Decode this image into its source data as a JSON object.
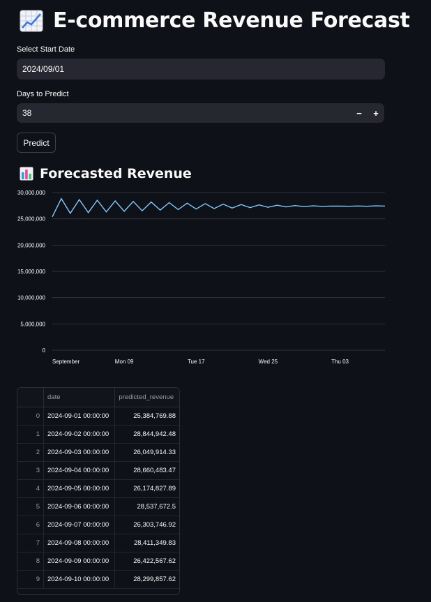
{
  "header": {
    "title": "E-commerce Revenue Forecast",
    "icon": "chart-increasing-icon"
  },
  "form": {
    "start_date_label": "Select Start Date",
    "start_date_value": "2024/09/01",
    "days_label": "Days to Predict",
    "days_value": "38",
    "minus_label": "−",
    "plus_label": "+",
    "predict_label": "Predict"
  },
  "forecast": {
    "title": "Forecasted Revenue",
    "icon": "bar-chart-icon"
  },
  "chart_data": {
    "type": "line",
    "y_ticks": [
      "30,000,000",
      "25,000,000",
      "20,000,000",
      "15,000,000",
      "10,000,000",
      "5,000,000",
      "0"
    ],
    "x_ticks": [
      "September",
      "Mon 09",
      "Tue 17",
      "Wed 25",
      "Thu 03"
    ],
    "ylim": [
      0,
      30000000
    ],
    "grid": true,
    "line_color": "#83c9ff",
    "x": [
      "2024-09-01",
      "2024-09-02",
      "2024-09-03",
      "2024-09-04",
      "2024-09-05",
      "2024-09-06",
      "2024-09-07",
      "2024-09-08",
      "2024-09-09",
      "2024-09-10",
      "2024-09-11",
      "2024-09-12",
      "2024-09-13",
      "2024-09-14",
      "2024-09-15",
      "2024-09-16",
      "2024-09-17",
      "2024-09-18",
      "2024-09-19",
      "2024-09-20",
      "2024-09-21",
      "2024-09-22",
      "2024-09-23",
      "2024-09-24",
      "2024-09-25",
      "2024-09-26",
      "2024-09-27",
      "2024-09-28",
      "2024-09-29",
      "2024-09-30",
      "2024-10-01",
      "2024-10-02",
      "2024-10-03",
      "2024-10-04",
      "2024-10-05",
      "2024-10-06",
      "2024-10-07",
      "2024-10-08"
    ],
    "values": [
      25384769.88,
      28844942.48,
      26049914.33,
      28660483.47,
      26174827.89,
      28537672.5,
      26303746.92,
      28411349.83,
      26422567.62,
      28299857.62,
      26540000,
      28190000,
      26650000,
      28080000,
      26760000,
      27980000,
      26860000,
      27890000,
      26950000,
      27800000,
      27040000,
      27720000,
      27120000,
      27650000,
      27190000,
      27580000,
      27260000,
      27520000,
      27320000,
      27470000,
      27370000,
      27430000,
      27410000,
      27390000,
      27440000,
      27380000,
      27460000,
      27420000
    ]
  },
  "table": {
    "columns": [
      "",
      "date",
      "predicted_revenue"
    ],
    "rows": [
      [
        "0",
        "2024-09-01 00:00:00",
        "25,384,769.88"
      ],
      [
        "1",
        "2024-09-02 00:00:00",
        "28,844,942.48"
      ],
      [
        "2",
        "2024-09-03 00:00:00",
        "26,049,914.33"
      ],
      [
        "3",
        "2024-09-04 00:00:00",
        "28,660,483.47"
      ],
      [
        "4",
        "2024-09-05 00:00:00",
        "26,174,827.89"
      ],
      [
        "5",
        "2024-09-06 00:00:00",
        "28,537,672.5"
      ],
      [
        "6",
        "2024-09-07 00:00:00",
        "26,303,746.92"
      ],
      [
        "7",
        "2024-09-08 00:00:00",
        "28,411,349.83"
      ],
      [
        "8",
        "2024-09-09 00:00:00",
        "26,422,567.62"
      ],
      [
        "9",
        "2024-09-10 00:00:00",
        "28,299,857.62"
      ]
    ]
  }
}
